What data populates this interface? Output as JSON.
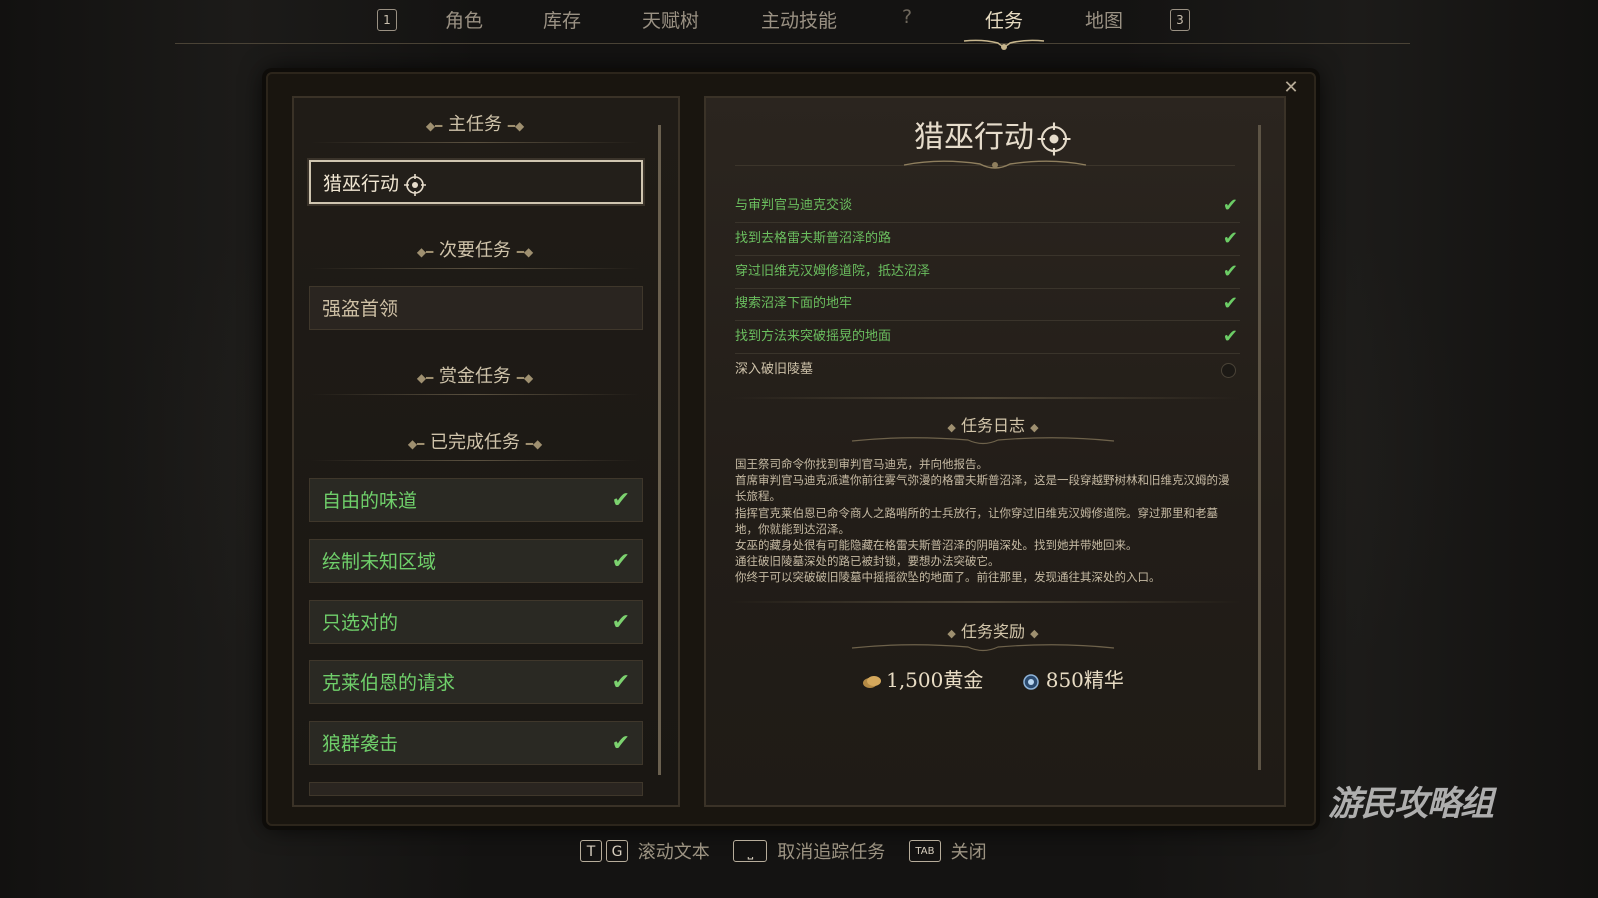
{
  "nav": {
    "left_key": "1",
    "right_key": "3",
    "tabs": [
      {
        "label": "角色",
        "active": false
      },
      {
        "label": "库存",
        "active": false
      },
      {
        "label": "天赋树",
        "active": false
      },
      {
        "label": "主动技能",
        "active": false
      },
      {
        "label": "?",
        "active": false
      },
      {
        "label": "任务",
        "active": true
      },
      {
        "label": "地图",
        "active": false
      }
    ]
  },
  "sidebar": {
    "main_header": "主任务",
    "main_quest": "猎巫行动",
    "side_header": "次要任务",
    "side_quest": "强盗首领",
    "bounty_header": "赏金任务",
    "completed_header": "已完成任务",
    "completed": [
      {
        "label": "自由的味道",
        "done": true
      },
      {
        "label": "绘制未知区域",
        "done": true
      },
      {
        "label": "只选对的",
        "done": true
      },
      {
        "label": "克莱伯恩的请求",
        "done": true
      },
      {
        "label": "狼群袭击",
        "done": true
      }
    ]
  },
  "detail": {
    "title": "猎巫行动",
    "objectives": [
      {
        "text": "与审判官马迪克交谈",
        "done": true
      },
      {
        "text": "找到去格雷夫斯普沼泽的路",
        "done": true
      },
      {
        "text": "穿过旧维克汉姆修道院，抵达沼泽",
        "done": true
      },
      {
        "text": "搜索沼泽下面的地牢",
        "done": true
      },
      {
        "text": "找到方法来突破摇晃的地面",
        "done": true
      },
      {
        "text": "深入破旧陵墓",
        "done": false
      }
    ],
    "journal_header": "任务日志",
    "journal": [
      "国王祭司命令你找到审判官马迪克，并向他报告。",
      "首席审判官马迪克派遣你前往雾气弥漫的格雷夫斯普沼泽，这是一段穿越野树林和旧维克汉姆的漫长旅程。",
      "指挥官克莱伯恩已命令商人之路哨所的士兵放行，让你穿过旧维克汉姆修道院。穿过那里和老墓地，你就能到达沼泽。",
      "女巫的藏身处很有可能隐藏在格雷夫斯普沼泽的阴暗深处。找到她并带她回来。",
      "通往破旧陵墓深处的路已被封锁，要想办法突破它。",
      "你终于可以突破破旧陵墓中摇摇欲坠的地面了。前往那里，发现通往其深处的入口。"
    ],
    "rewards_header": "任务奖励",
    "rewards": {
      "gold": "1,500黄金",
      "essence": "850精华"
    }
  },
  "hints": {
    "scroll_keys": [
      "T",
      "G"
    ],
    "scroll_label": "滚动文本",
    "untrack_label": "取消追踪任务",
    "close_key": "TAB",
    "close_label": "关闭"
  },
  "watermark": "游民攻略组",
  "colors": {
    "completed_green": "#6fcf6a",
    "text_gold": "#d8cbb0",
    "panel_bg": "#221d18"
  }
}
